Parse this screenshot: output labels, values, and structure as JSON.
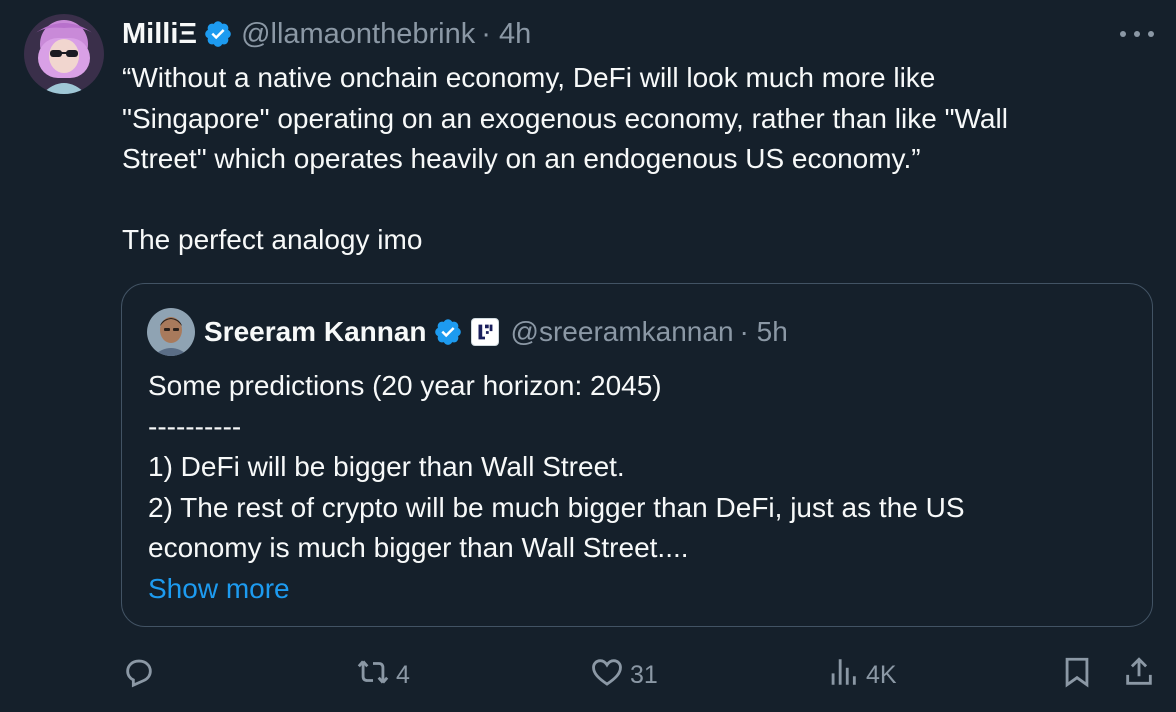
{
  "tweet": {
    "author_name": "MilliΞ",
    "handle": "@llamaonthebrink",
    "time": "· 4h",
    "text_lines": [
      "“Without a native onchain economy, DeFi will look much more like",
      "\"Singapore\" operating on an exogenous economy, rather than like \"Wall",
      "Street\" which operates heavily on an endogenous US economy.”",
      "The perfect analogy imo"
    ]
  },
  "quote": {
    "author_name": "Sreeram Kannan",
    "handle": "@sreeramkannan",
    "time": "· 5h",
    "text_lines": [
      "Some predictions (20 year horizon: 2045)",
      "----------",
      "1) DeFi will be bigger than Wall Street.",
      "2) The rest of crypto will be much bigger than DeFi, just as the US",
      "economy is much bigger than Wall Street...."
    ],
    "show_more": "Show more"
  },
  "actions": {
    "reply_count": "",
    "retweet_count": "4",
    "like_count": "31",
    "views_count": "4K"
  },
  "icons": {
    "reply": "reply-icon",
    "retweet": "retweet-icon",
    "like": "heart-icon",
    "views": "views-icon",
    "bookmark": "bookmark-icon",
    "share": "share-icon",
    "more": "more-icon",
    "verified": "verified-badge-icon"
  },
  "colors": {
    "background": "#15202b",
    "text": "#f7f9f9",
    "secondary": "#8b98a5",
    "accent": "#1d9bf0",
    "border": "#425364"
  }
}
